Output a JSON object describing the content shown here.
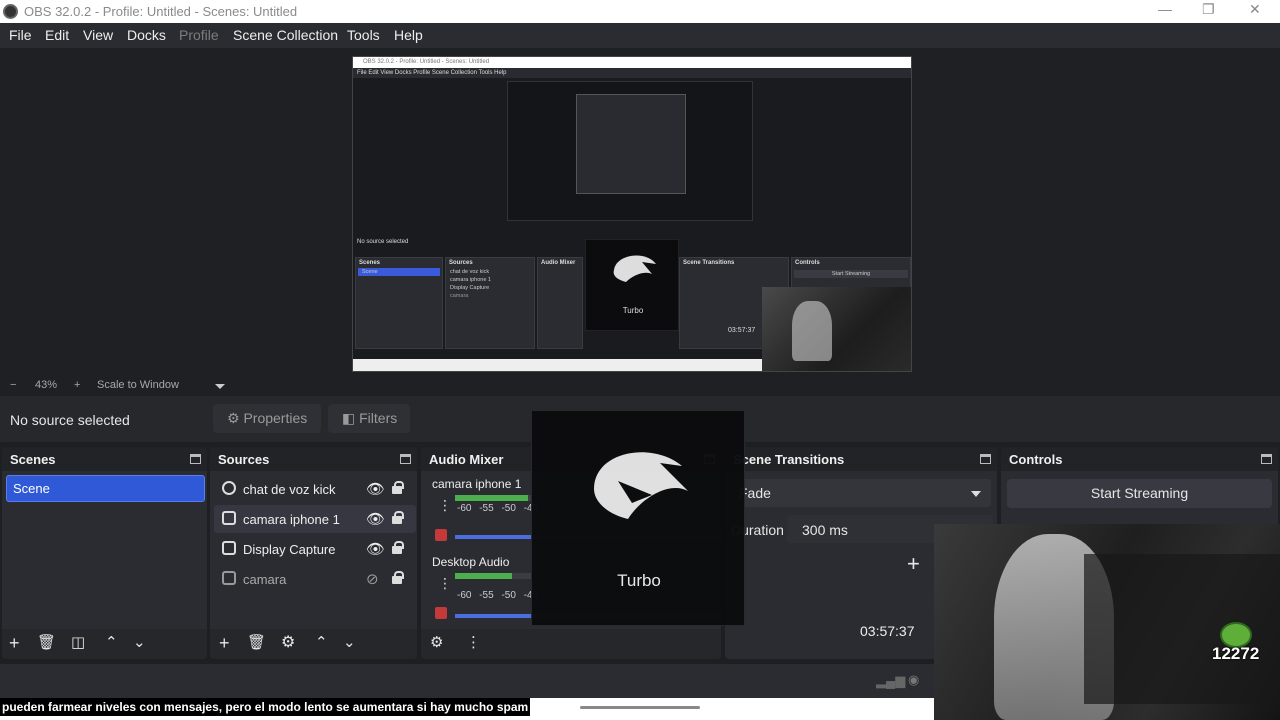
{
  "window": {
    "title": "OBS 32.0.2 - Profile: Untitled - Scenes: Untitled",
    "minimize": "—",
    "maximize": "❐",
    "close": "✕"
  },
  "menu": [
    "File",
    "Edit",
    "View",
    "Docks",
    "Profile",
    "Scene Collection",
    "Tools",
    "Help"
  ],
  "zoom": {
    "minus": "−",
    "percent": "43%",
    "plus": "+",
    "mode": "Scale to Window"
  },
  "context": {
    "no_source": "No source selected",
    "properties": "Properties",
    "filters": "Filters"
  },
  "scenes": {
    "title": "Scenes",
    "items": [
      "Scene"
    ]
  },
  "sources": {
    "title": "Sources",
    "items": [
      "chat de voz kick",
      "camara iphone 1",
      "Display Capture",
      "camara"
    ]
  },
  "audio": {
    "title": "Audio Mixer",
    "channels": [
      {
        "name": "camara iphone 1",
        "level": 0.28,
        "volume": 0.3
      },
      {
        "name": "Desktop Audio",
        "level": 0.22,
        "volume": 0.3
      }
    ],
    "ticks": "-60 -55 -50 -45"
  },
  "transitions": {
    "title": "Scene Transitions",
    "type": "Fade",
    "duration_label": "Duration",
    "duration": "300 ms"
  },
  "controls": {
    "title": "Controls",
    "start_streaming": "Start Streaming"
  },
  "overlay": {
    "turbo_label": "Turbo",
    "clock": "03:57:37",
    "badge_count": "12272"
  },
  "caption": "pueden farmear niveles con mensajes, pero el modo lento se aumentara si hay mucho spam",
  "mini": {
    "title": "OBS 32.0.2 - Profile: Untitled - Scenes: Untitled",
    "menu": "File   Edit   View   Docks   Profile   Scene Collection   Tools   Help",
    "no_source": "No source selected",
    "turbo": "Turbo",
    "clock": "03:57:37",
    "scenes": "Scenes",
    "scene": "Scene",
    "sources": "Sources",
    "audio": "Audio Mixer",
    "transitions": "Scene Transitions",
    "controls": "Controls",
    "start": "Start Streaming",
    "src1": "chat de voz kick",
    "src2": "camara iphone 1",
    "src3": "Display Capture",
    "src4": "camara"
  }
}
